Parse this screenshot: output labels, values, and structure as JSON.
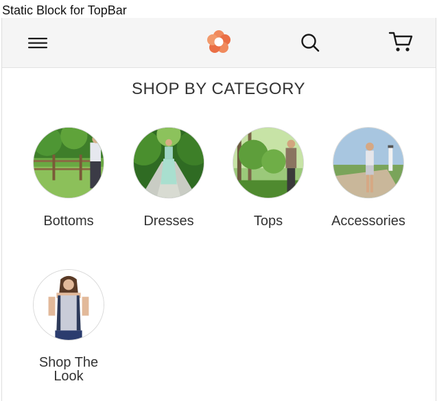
{
  "static_block": {
    "text": "Static Block for TopBar"
  },
  "topbar": {
    "menu_icon": "hamburger-menu-icon",
    "logo_icon": "flower-logo-icon",
    "search_icon": "search-icon",
    "cart_icon": "cart-icon",
    "logo_color": "#ef7b4d"
  },
  "section": {
    "title": "SHOP BY CATEGORY"
  },
  "categories": [
    {
      "label": "Bottoms"
    },
    {
      "label": "Dresses"
    },
    {
      "label": "Tops"
    },
    {
      "label": "Accessories"
    },
    {
      "label": "Shop The Look"
    }
  ]
}
